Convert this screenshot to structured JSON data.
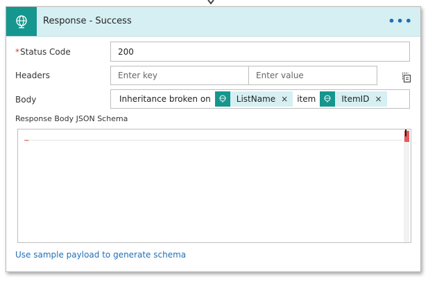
{
  "header": {
    "title": "Response - Success",
    "menu_label": "•••",
    "icon": "globe-icon",
    "accent_color": "#15968e",
    "header_bg": "#d6eff2"
  },
  "fields": {
    "status_code": {
      "label": "Status Code",
      "required_marker": "*",
      "value": "200"
    },
    "headers": {
      "label": "Headers",
      "key_placeholder": "Enter key",
      "value_placeholder": "Enter value"
    },
    "body": {
      "label": "Body",
      "text_before": "Inheritance broken on",
      "token1": "ListName",
      "text_between": "item",
      "token2": "ItemID",
      "token_remove": "×"
    },
    "schema": {
      "label": "Response Body JSON Schema"
    }
  },
  "footer": {
    "link": "Use sample payload to generate schema"
  }
}
